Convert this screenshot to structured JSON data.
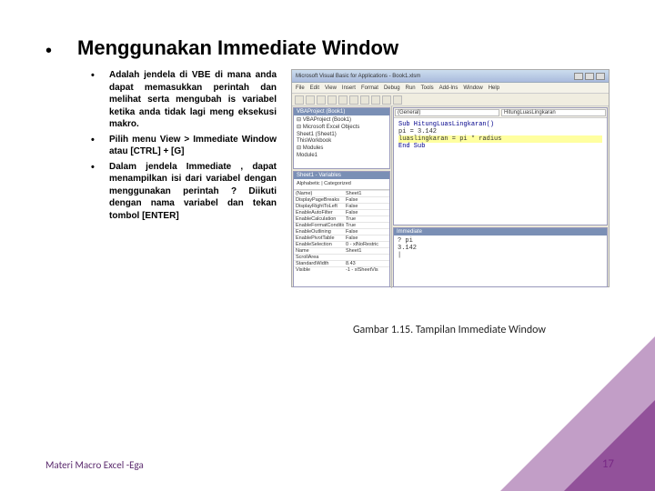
{
  "title": "Menggunakan Immediate Window",
  "bullets": [
    "Adalah jendela di VBE di mana anda dapat memasukkan perintah dan melihat serta mengubah is variabel ketika anda tidak lagi meng eksekusi makro.",
    "Pilih menu View > Immediate Window atau [CTRL] + [G]",
    "Dalam jendela Immediate , dapat menampilkan isi dari variabel dengan menggunakan perintah ? Diikuti dengan nama variabel dan tekan tombol [ENTER]"
  ],
  "vbe": {
    "window_title": "Microsoft Visual Basic for Applications - Book1.xlsm",
    "menu": [
      "File",
      "Edit",
      "View",
      "Insert",
      "Format",
      "Debug",
      "Run",
      "Tools",
      "Add-Ins",
      "Window",
      "Help"
    ],
    "project_title": "VBAProject (Book1)",
    "tree": [
      "⊟ VBAProject (Book1)",
      "  ⊟ Microsoft Excel Objects",
      "    Sheet1 (Sheet1)",
      "    ThisWorkbook",
      "  ⊟ Modules",
      "    Module1"
    ],
    "props_title": "Sheet1 - Variables",
    "props_tab": "Alphabetic | Categorized",
    "props": [
      [
        "(Name)",
        "Sheet1"
      ],
      [
        "DisplayPageBreaks",
        "False"
      ],
      [
        "DisplayRightToLeft",
        "False"
      ],
      [
        "EnableAutoFilter",
        "False"
      ],
      [
        "EnableCalculation",
        "True"
      ],
      [
        "EnableFormatConditions",
        "True"
      ],
      [
        "EnableOutlining",
        "False"
      ],
      [
        "EnablePivotTable",
        "False"
      ],
      [
        "EnableSelection",
        "0 - xlNoRestric"
      ],
      [
        "Name",
        "Sheet1"
      ],
      [
        "ScrollArea",
        ""
      ],
      [
        "StandardWidth",
        "8.43"
      ],
      [
        "Visible",
        "-1 - xlSheetVis"
      ]
    ],
    "code_dd_left": "(General)",
    "code_dd_right": "HitungLuasLingkaran",
    "code_lines": [
      {
        "t": "Sub HitungLuasLingkaran()",
        "kw": true
      },
      {
        "t": "pi = 3.142"
      },
      {
        "t": "luaslingkaran = pi * radius",
        "hl": true
      },
      {
        "t": "End Sub",
        "kw": true
      }
    ],
    "imm_title": "Immediate",
    "imm_lines": [
      "? pi",
      " 3.142",
      "|"
    ]
  },
  "caption": "Gambar 1.15. Tampilan Immediate Window",
  "footer": "Materi Macro Excel -Ega",
  "page": "17"
}
